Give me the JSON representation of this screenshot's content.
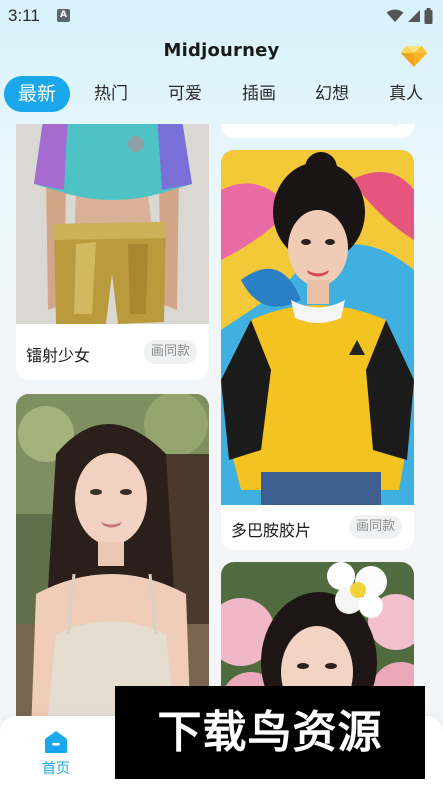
{
  "status_bar": {
    "time": "3:11",
    "notification_icon": "A"
  },
  "header": {
    "title": "Midjourney",
    "vip_icon": "diamond-icon"
  },
  "tabs": [
    {
      "label": "最新",
      "active": true
    },
    {
      "label": "热门",
      "active": false
    },
    {
      "label": "可爱",
      "active": false
    },
    {
      "label": "插画",
      "active": false
    },
    {
      "label": "幻想",
      "active": false
    },
    {
      "label": "真人",
      "active": false
    }
  ],
  "feed": {
    "cards": [
      {
        "title": "",
        "image": "fashion-crop-top-photo"
      },
      {
        "title": "镭射少女",
        "action": "画同款",
        "image": "girl-gold-shorts-photo"
      },
      {
        "title": "多巴胺胶片",
        "action": "画同款",
        "image": "girl-yellow-sweater-photo"
      },
      {
        "title": "",
        "image": "girl-white-camisole-photo"
      },
      {
        "title": "",
        "image": "girl-flowers-photo"
      }
    ]
  },
  "bottom_nav": {
    "home_label": "首页"
  },
  "watermark": {
    "text": "下载鸟资源"
  },
  "colors": {
    "accent": "#1aa7ec",
    "background": "#e9f7fc",
    "card": "#ffffff"
  }
}
